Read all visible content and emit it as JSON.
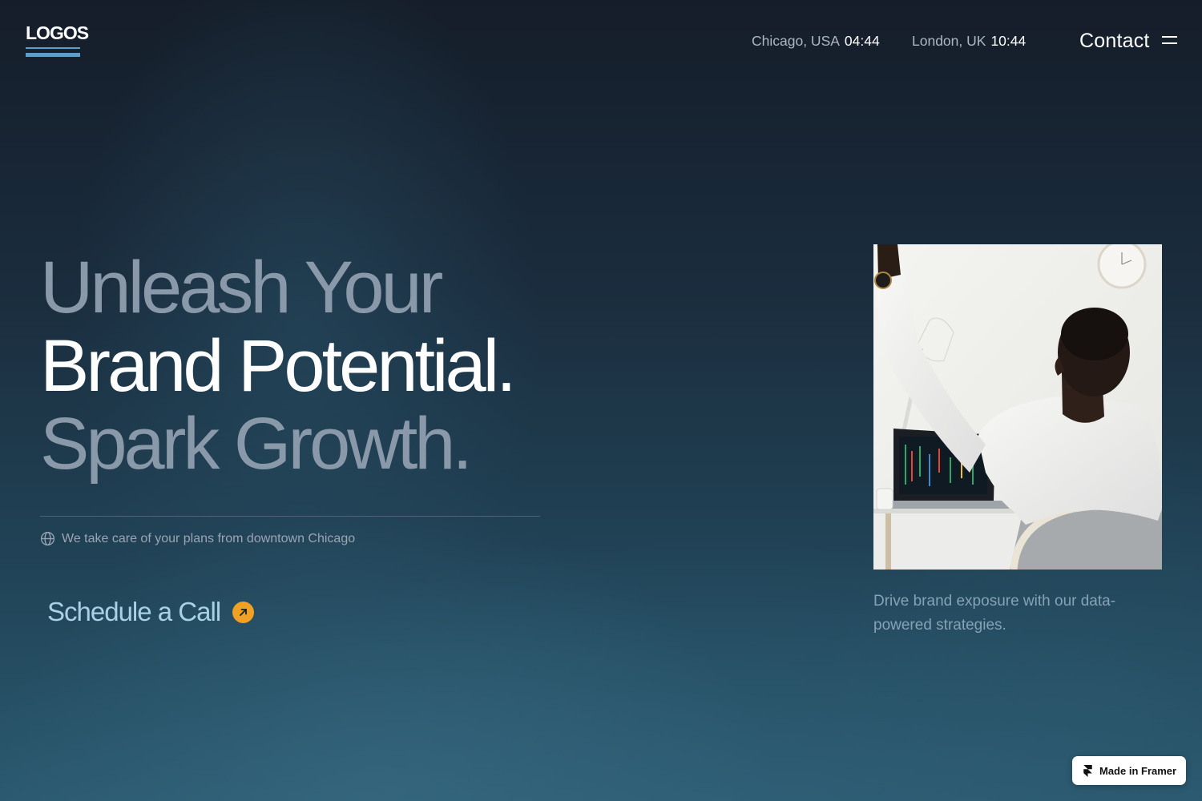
{
  "header": {
    "logo": "LOGOS",
    "clocks": [
      {
        "city": "Chicago, USA",
        "time": "04:44"
      },
      {
        "city": "London, UK",
        "time": "10:44"
      }
    ],
    "contact_label": "Contact",
    "menu_icon": "hamburger-menu-icon"
  },
  "hero": {
    "line1": "Unleash Your",
    "line2": "Brand Potential.",
    "line3": "Spark Growth.",
    "location_icon": "globe-icon",
    "location_text": "We take care of your plans from downtown Chicago",
    "cta_label": "Schedule a Call",
    "cta_icon": "arrow-up-right-icon"
  },
  "aside": {
    "photo_alt": "man stretching at desk with laptop",
    "caption": "Drive brand exposure with our data-powered strategies."
  },
  "badge": {
    "label": "Made in Framer",
    "icon": "framer-logo-icon"
  },
  "colors": {
    "accent": "#f0a024",
    "cta_text": "#a9d1e6",
    "logo_underline": "#5d9fc6"
  }
}
